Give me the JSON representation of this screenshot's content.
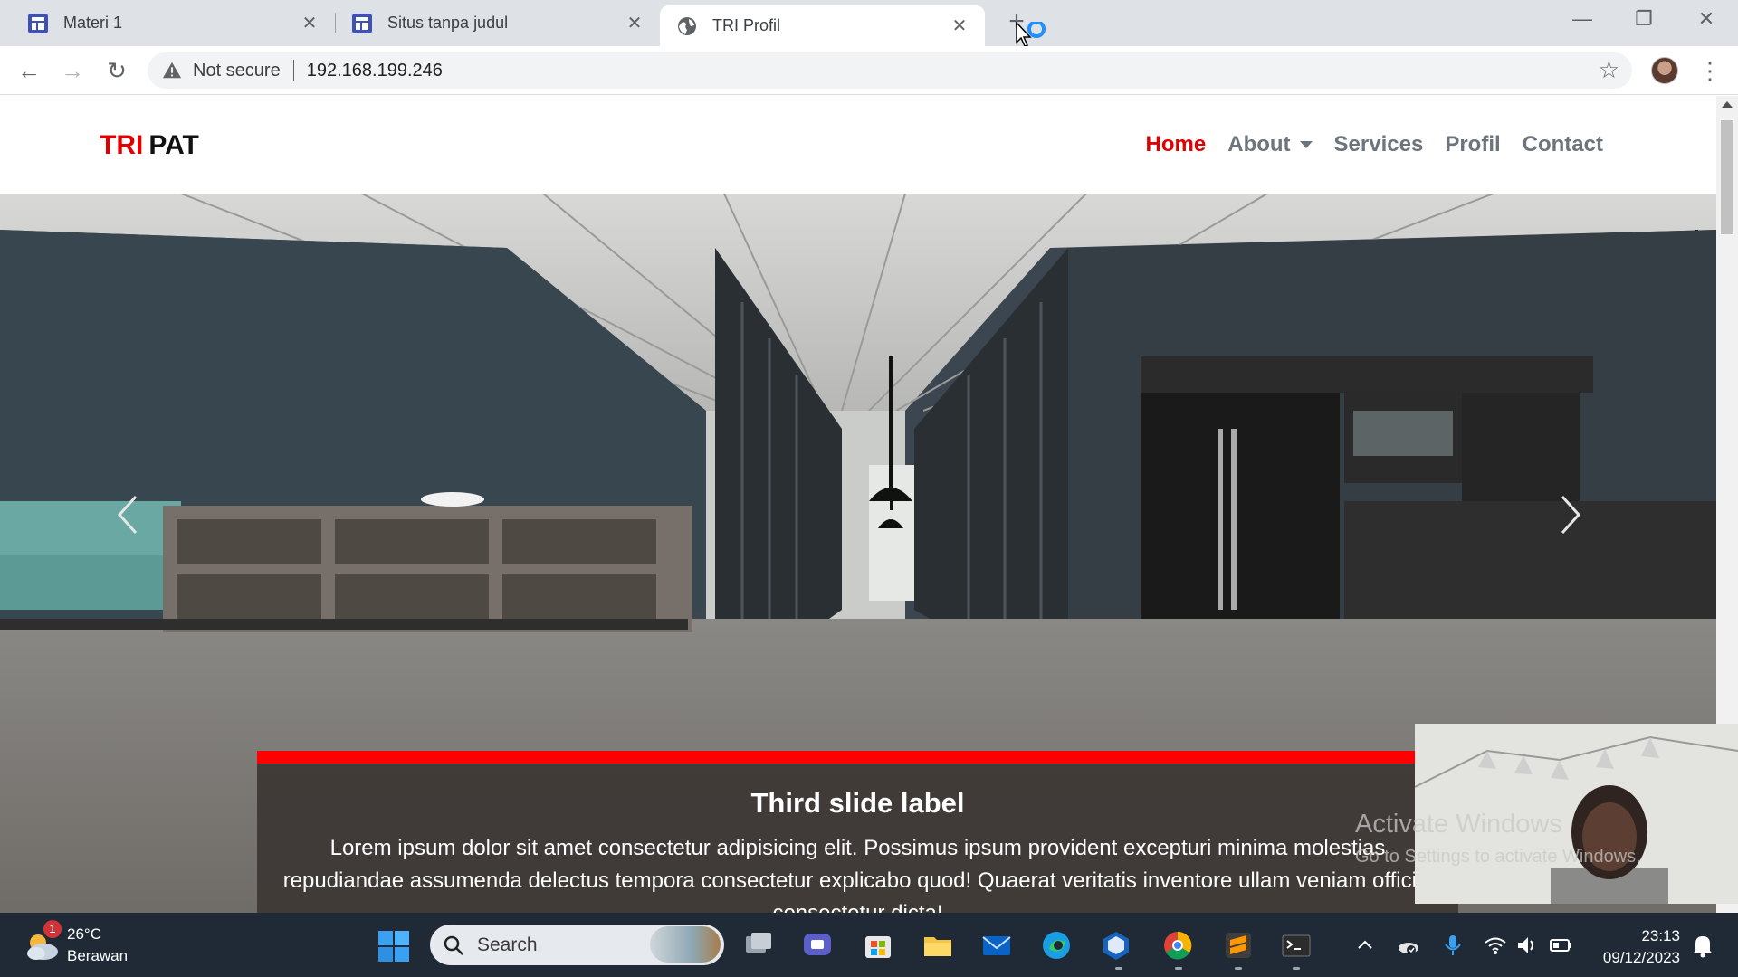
{
  "browser": {
    "tabs": [
      {
        "title": "Materi 1",
        "icon": "sites-icon",
        "active": false
      },
      {
        "title": "Situs tanpa judul",
        "icon": "sites-icon",
        "active": false
      },
      {
        "title": "TRI Profil",
        "icon": "globe-icon",
        "active": true
      }
    ],
    "address": {
      "security_label": "Not secure",
      "url": "192.168.199.246"
    }
  },
  "site": {
    "brand": {
      "part1": "TRI",
      "part2": "PAT"
    },
    "nav": [
      {
        "label": "Home",
        "active": true
      },
      {
        "label": "About",
        "dropdown": true
      },
      {
        "label": "Services"
      },
      {
        "label": "Profil"
      },
      {
        "label": "Contact"
      }
    ],
    "carousel": {
      "caption_title": "Third slide label",
      "caption_text": "Lorem ipsum dolor sit amet consectetur adipisicing elit. Possimus ipsum provident excepturi minima molestias repudiandae assumenda delectus tempora consectetur explicabo quod! Quaerat veritatis inventore ullam veniam officiis consectetur dicta!",
      "indicator_count": 3,
      "active_index": 2,
      "accent_color": "#ff0000"
    },
    "brand_color": "#e10000"
  },
  "overlay": {
    "activate_title": "Activate Windows",
    "activate_sub": "Go to Settings to activate Windows."
  },
  "taskbar": {
    "weather": {
      "temp": "26°C",
      "condition": "Berawan",
      "badge": "1"
    },
    "search_placeholder": "Search",
    "clock": {
      "time": "23:13",
      "date": "09/12/2023"
    }
  }
}
